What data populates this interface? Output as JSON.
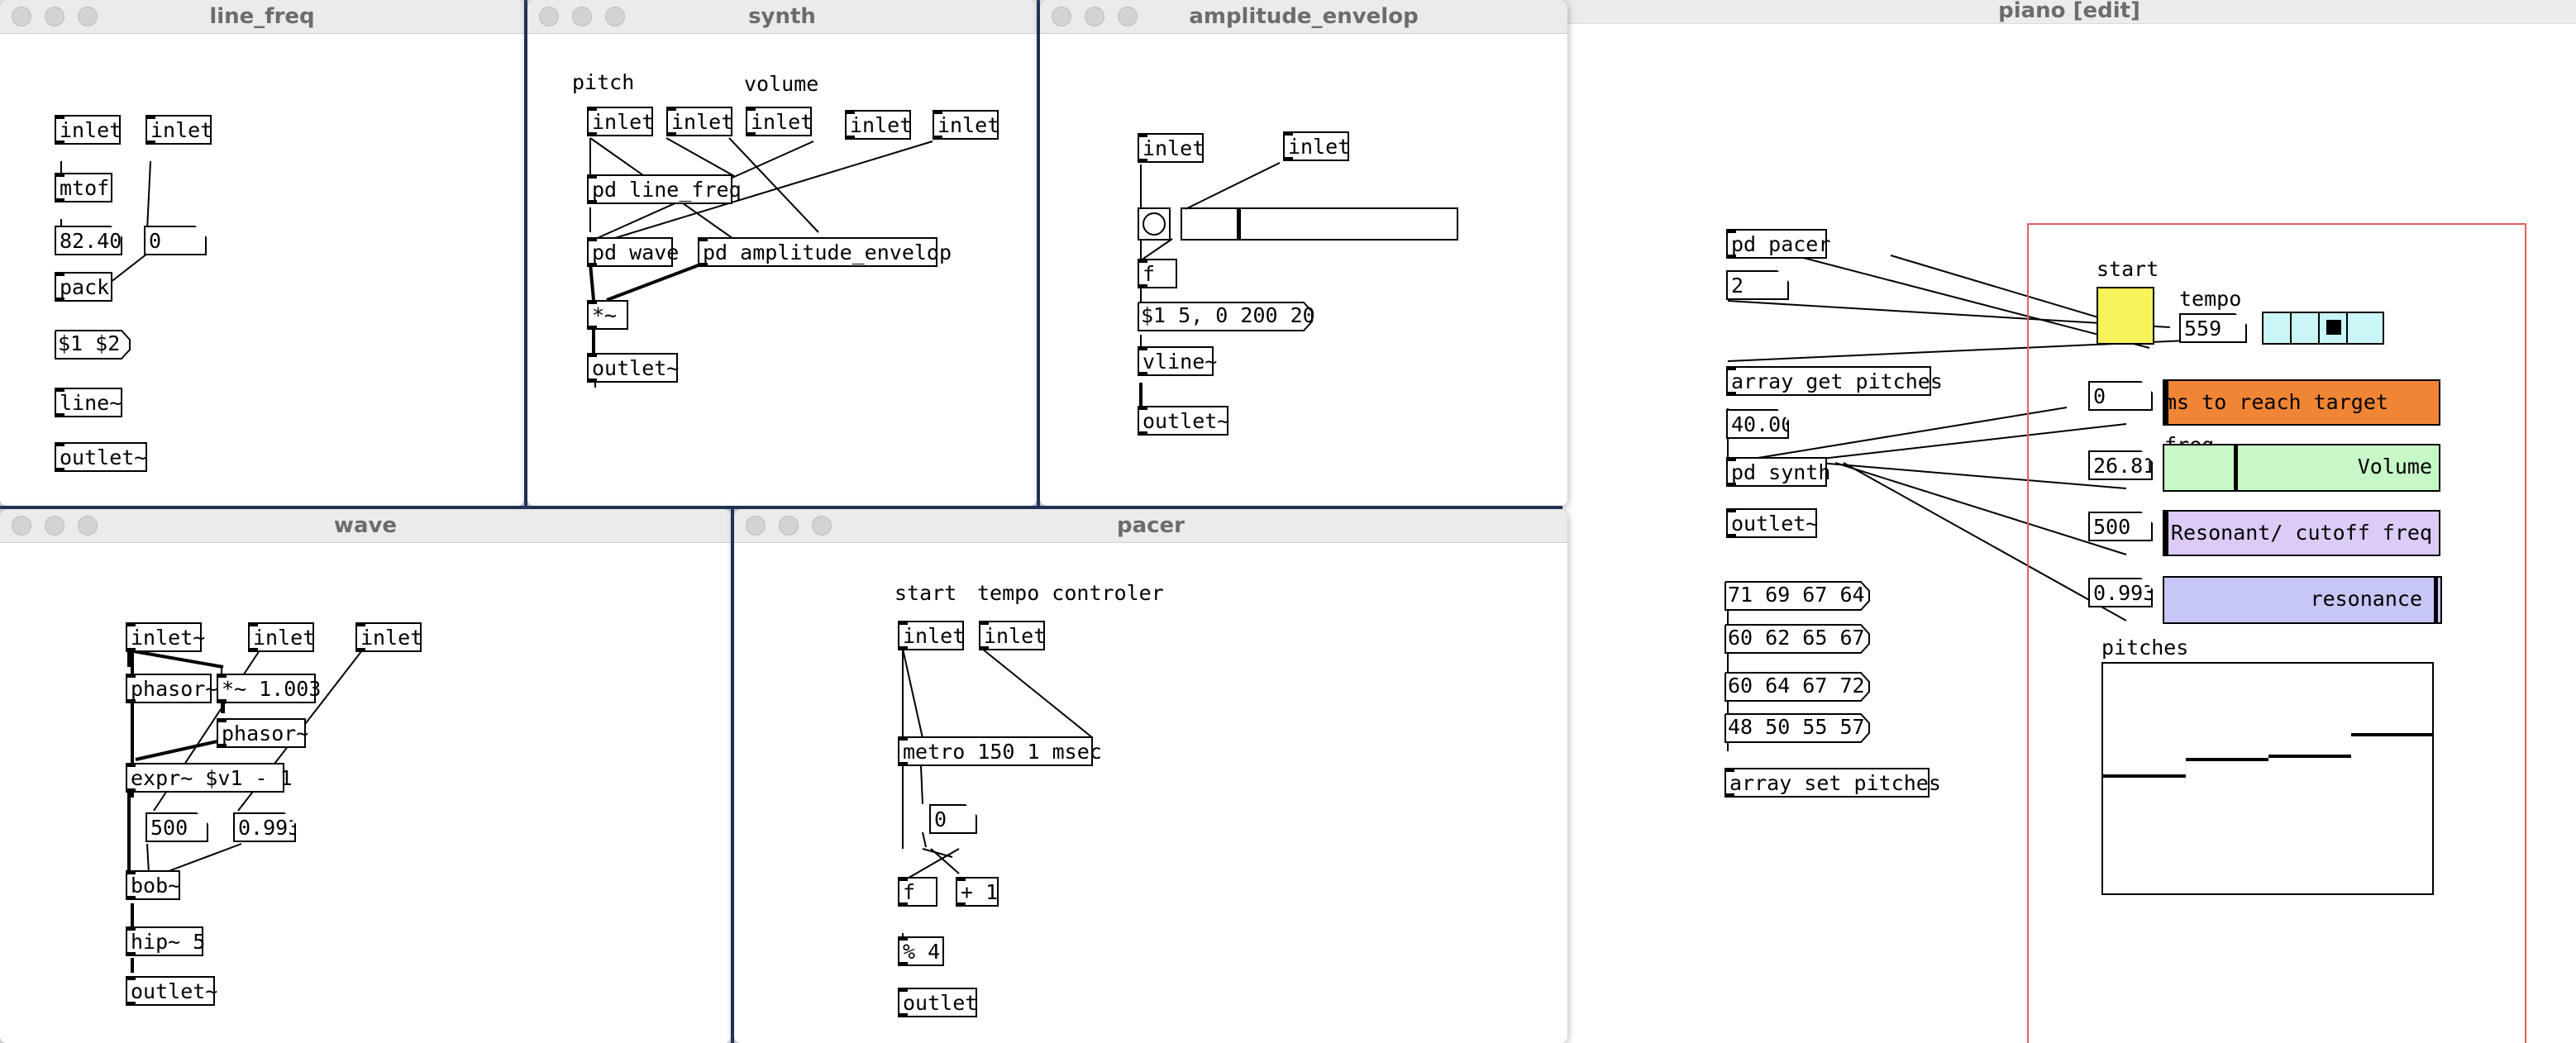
{
  "windows": {
    "line_freq": {
      "title": "line_freq",
      "objects": [
        "inlet",
        "inlet",
        "mtof",
        "pack",
        "$1 $2",
        "line~",
        "outlet~"
      ],
      "numbers": [
        "82.40",
        "0"
      ]
    },
    "synth": {
      "title": "synth",
      "labels": [
        "pitch",
        "volume"
      ],
      "objects": [
        "inlet",
        "inlet",
        "inlet",
        "inlet",
        "inlet",
        "pd line_freq",
        "pd wave",
        "pd amplitude_envelop",
        "*~",
        "outlet~"
      ]
    },
    "amplitude_envelop": {
      "title": "amplitude_envelop",
      "objects": [
        "inlet",
        "inlet",
        "f",
        "$1 5, 0 200 20",
        "vline~",
        "outlet~"
      ]
    },
    "wave": {
      "title": "wave",
      "objects": [
        "inlet~",
        "inlet",
        "inlet",
        "phasor~",
        "*~ 1.003",
        "phasor~",
        "expr~ $v1 - 1",
        "bob~",
        "hip~ 5",
        "outlet~"
      ],
      "numbers": [
        "500",
        "0.993"
      ]
    },
    "pacer": {
      "title": "pacer",
      "labels": [
        "start",
        "tempo controler"
      ],
      "objects": [
        "inlet",
        "inlet",
        "metro 150 1 msec",
        "f",
        "+ 1",
        "% 4",
        "outlet"
      ],
      "numbers": [
        "0"
      ]
    },
    "piano": {
      "title": "piano [edit]",
      "objects": [
        "pd pacer",
        "array get pitches",
        "pd synth",
        "outlet~",
        "array set pitches"
      ],
      "numbers": [
        "2",
        "40.00",
        "559",
        "0",
        "26.81",
        "500",
        "0.993"
      ],
      "messages": [
        "71 69 67 64",
        "60 62 65 67",
        "60 64 67 72",
        "48 50 55 57"
      ],
      "labels": {
        "start": "start",
        "tempo": "tempo",
        "pitches": "pitches"
      },
      "sliders": [
        {
          "label": "ms to reach target freq",
          "color": "#f08535",
          "level": 0.0
        },
        {
          "label": "Volume",
          "color": "#c8f7c8",
          "level": 0.27
        },
        {
          "label": "Resonant/ cutoff freq",
          "color": "#dccbf7",
          "level": 0.0
        },
        {
          "label": "resonance",
          "color": "#c6c6f7",
          "level": 0.99
        }
      ],
      "radio": {
        "count": 4,
        "selected": 2
      },
      "array": {
        "name": "pitches",
        "values": [
          40,
          43,
          44,
          50
        ]
      }
    }
  }
}
